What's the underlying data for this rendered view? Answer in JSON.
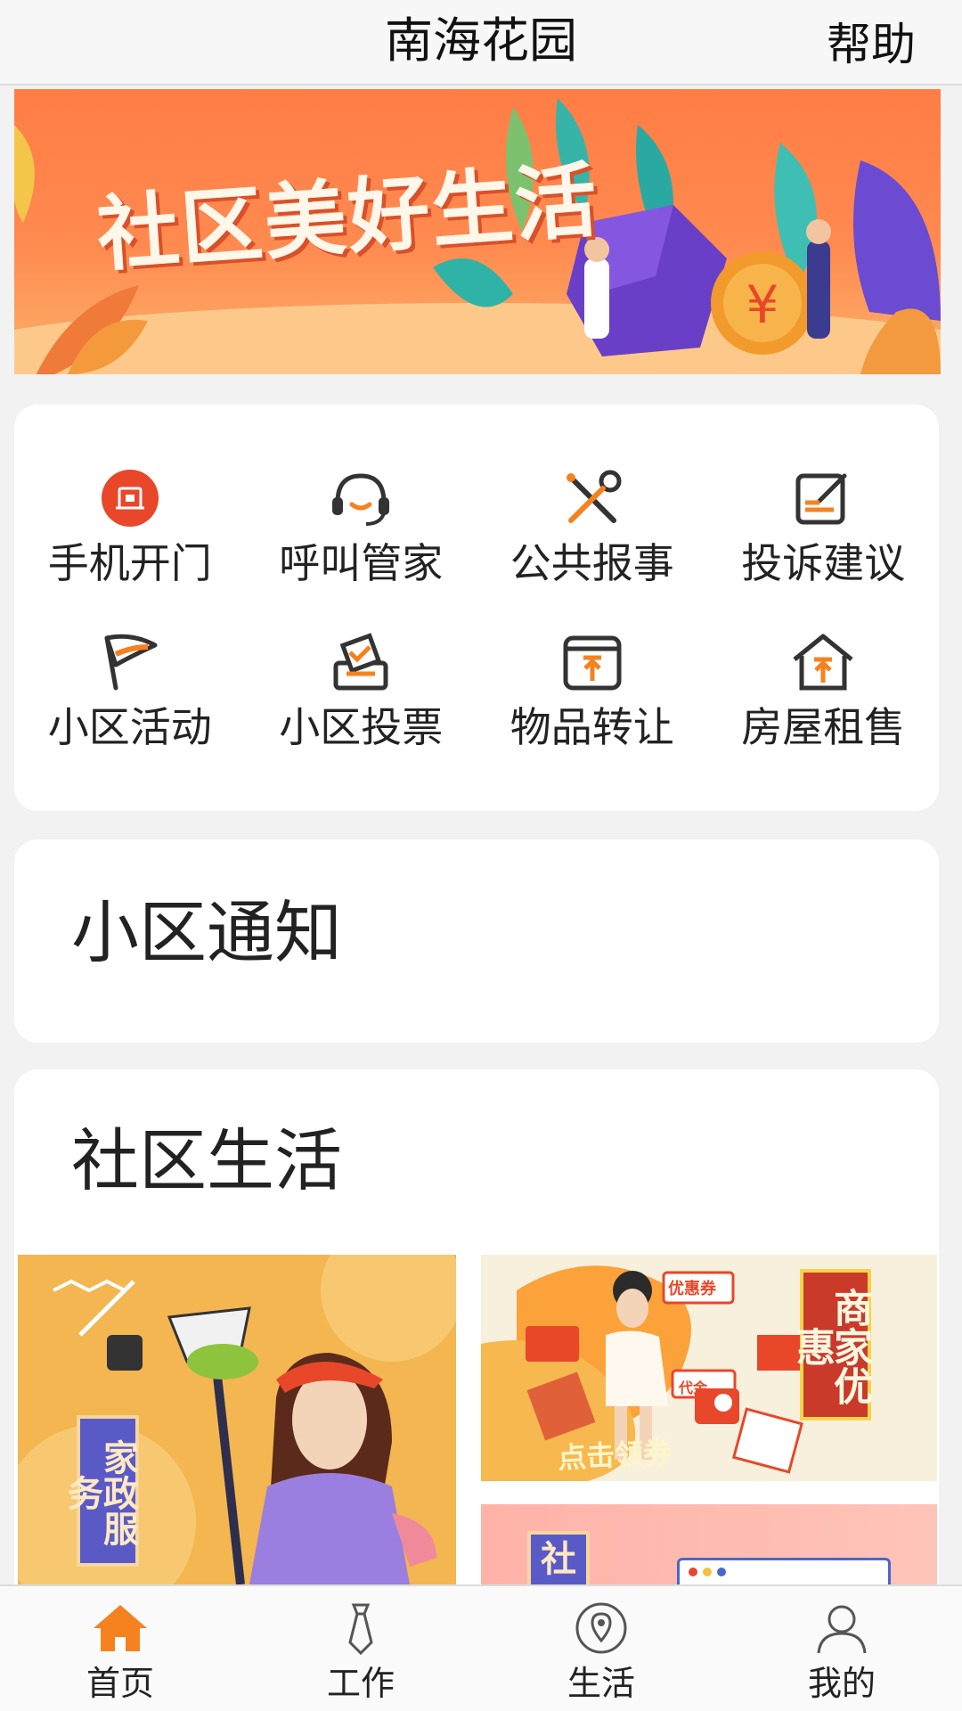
{
  "header": {
    "title": "南海花园",
    "help_label": "帮助"
  },
  "banner": {
    "text": "社区美好生活"
  },
  "services": [
    {
      "label": "手机开门",
      "icon": "door-open-icon"
    },
    {
      "label": "呼叫管家",
      "icon": "headset-icon"
    },
    {
      "label": "公共报事",
      "icon": "repair-tools-icon"
    },
    {
      "label": "投诉建议",
      "icon": "feedback-edit-icon"
    },
    {
      "label": "小区活动",
      "icon": "flag-icon"
    },
    {
      "label": "小区投票",
      "icon": "vote-box-icon"
    },
    {
      "label": "物品转让",
      "icon": "transfer-box-icon"
    },
    {
      "label": "房屋租售",
      "icon": "house-rent-icon"
    }
  ],
  "notice": {
    "title": "小区通知"
  },
  "life": {
    "title": "社区生活",
    "housekeeping_label": "家政服务",
    "merchant_label": "商家优惠",
    "merchant_cta": "点击领券",
    "merchant_coupon": "优惠券",
    "merchant_voucher": "代金",
    "community_label": "社"
  },
  "tabbar": [
    {
      "label": "首页",
      "icon": "home-icon",
      "active": true
    },
    {
      "label": "工作",
      "icon": "tie-icon",
      "active": false
    },
    {
      "label": "生活",
      "icon": "location-pin-icon",
      "active": false
    },
    {
      "label": "我的",
      "icon": "user-icon",
      "active": false
    }
  ],
  "colors": {
    "accent": "#f5821f",
    "danger": "#e8472a",
    "icon_dark": "#333333"
  }
}
